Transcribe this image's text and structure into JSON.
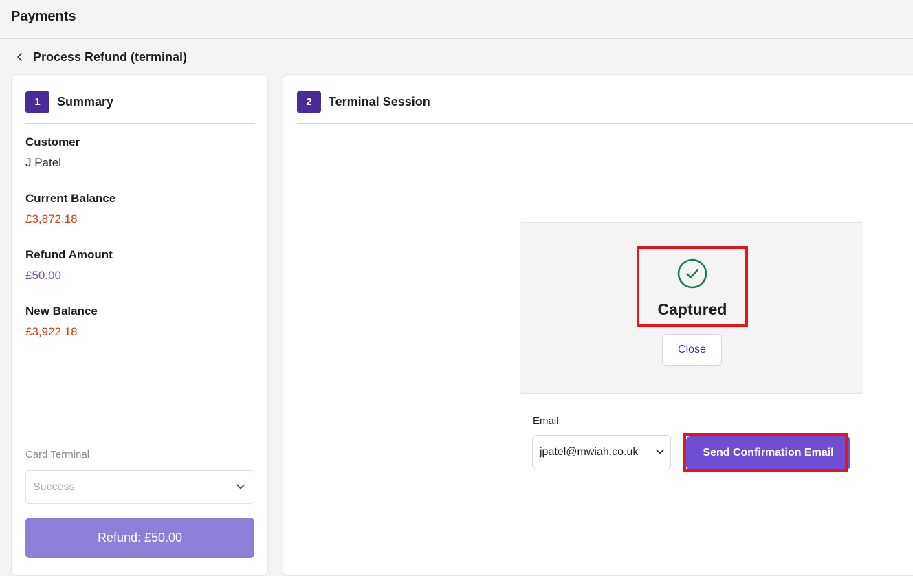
{
  "app": {
    "title": "Payments"
  },
  "breadcrumb": {
    "title": "Process Refund (terminal)",
    "back_icon": "chevron-left-icon"
  },
  "summary": {
    "step_number": "1",
    "step_title": "Summary",
    "customer_label": "Customer",
    "customer_value": "J Patel",
    "current_balance_label": "Current Balance",
    "current_balance_value": "£3,872.18",
    "refund_amount_label": "Refund Amount",
    "refund_amount_value": "£50.00",
    "new_balance_label": "New Balance",
    "new_balance_value": "£3,922.18",
    "card_terminal_label": "Card Terminal",
    "card_terminal_value": "Success",
    "refund_button_label": "Refund: £50.00"
  },
  "terminal": {
    "step_number": "2",
    "step_title": "Terminal Session",
    "status_icon": "check-circle-icon",
    "status_text": "Captured",
    "close_label": "Close",
    "email_label": "Email",
    "email_value": "jpatel@mwiah.co.uk",
    "send_label": "Send Confirmation Email"
  },
  "colors": {
    "accent": "#4b2a9a",
    "primary_button": "#6e4fd4",
    "disabled_button": "#8e80d8",
    "balance_red": "#d64010",
    "refund_purple": "#6a4fc8",
    "success_green": "#1e7a4e",
    "highlight_red": "#e8141b"
  }
}
